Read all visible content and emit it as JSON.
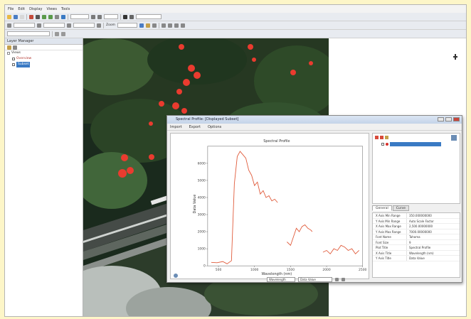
{
  "menubar": [
    "File",
    "Edit",
    "Display",
    "Views",
    "Tools"
  ],
  "layer_manager": {
    "title": "Layer Manager",
    "items": [
      "Views",
      "Overview",
      "Subset"
    ]
  },
  "toolbar": {
    "zoom": "Zoom"
  },
  "spectral_window": {
    "title": "Spectral Profile: [Displayed Subset]",
    "toolbar": [
      "Import",
      "Export",
      "Options"
    ],
    "tabs": [
      "General",
      "Curve"
    ],
    "properties": [
      [
        "X Axis Min Range",
        "350.000000000"
      ],
      [
        "Y Axis Min Range",
        "Auto Scale Factor"
      ],
      [
        "X Axis Max Range",
        "2,500.00000000"
      ],
      [
        "Y Axis Max Range",
        "7000.00000000"
      ],
      [
        "Font Name",
        "Tahoma"
      ],
      [
        "Font Size",
        "9"
      ],
      [
        "Plot Title",
        "Spectral Profile"
      ],
      [
        "X Axis Title",
        "Wavelength (nm)"
      ],
      [
        "Y Axis Title",
        "Data Value"
      ]
    ],
    "bottom_combos": [
      "Wavelength",
      "Data Value"
    ]
  },
  "chart_data": {
    "type": "line",
    "title": "Spectral Profile",
    "xlabel": "Wavelength (nm)",
    "ylabel": "Data Value",
    "xlim": [
      350,
      2500
    ],
    "ylim": [
      0,
      7000
    ],
    "xticks": [
      500,
      1000,
      1500,
      2000,
      2500
    ],
    "yticks": [
      0,
      1000,
      2000,
      3000,
      4000,
      5000,
      6000
    ],
    "color": "#e05a3a",
    "segments": [
      {
        "x": [
          400,
          480,
          560,
          620,
          680,
          720,
          760,
          800,
          840,
          880,
          920,
          960,
          1000,
          1040,
          1080,
          1120,
          1160,
          1200,
          1240,
          1280,
          1320
        ],
        "y": [
          200,
          180,
          250,
          120,
          300,
          4800,
          6400,
          6700,
          6500,
          6300,
          5600,
          5300,
          4700,
          4900,
          4200,
          4400,
          4000,
          4100,
          3800,
          3900,
          3700
        ]
      },
      {
        "x": [
          1450,
          1500,
          1540,
          1580,
          1620,
          1660,
          1700,
          1740,
          1780,
          1800
        ],
        "y": [
          1400,
          1200,
          1700,
          2200,
          2000,
          2300,
          2400,
          2200,
          2100,
          2000
        ]
      },
      {
        "x": [
          1950,
          2000,
          2050,
          2100,
          2150,
          2200,
          2250,
          2300,
          2350,
          2400,
          2450
        ],
        "y": [
          800,
          900,
          700,
          1000,
          900,
          1200,
          1100,
          900,
          1000,
          700,
          900
        ]
      }
    ]
  }
}
